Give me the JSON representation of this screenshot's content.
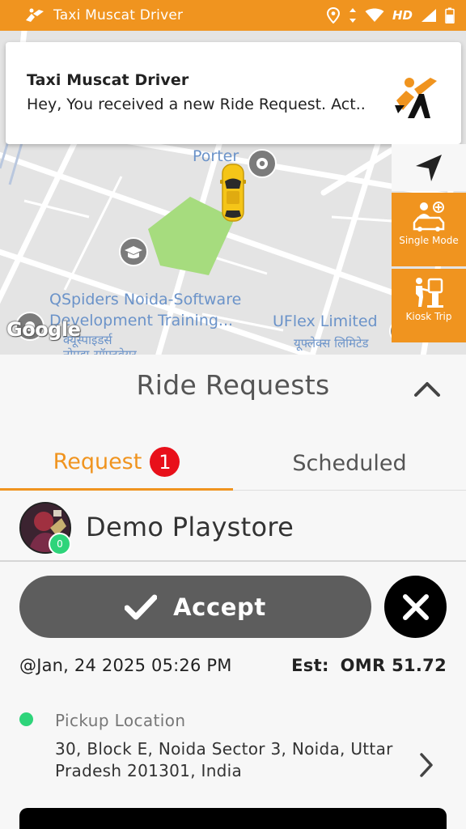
{
  "statusbar": {
    "app_name": "Taxi Muscat Driver",
    "network": "HD",
    "icons": [
      "app-taxi-icon",
      "location-icon",
      "data-arrows-icon",
      "wifi-icon",
      "signal-icon",
      "battery-icon"
    ]
  },
  "notification": {
    "title": "Taxi Muscat Driver",
    "body": "Hey, You received a new Ride Request. Act..",
    "logo": "taxi-logo-icon"
  },
  "map": {
    "pois": {
      "porter": "Porter",
      "qspiders_line1": "QSpiders Noida-Software",
      "qspiders_line2": "Development Training...",
      "qspiders_hindi1": "क्यूस्पाइडर्स",
      "qspiders_hindi2": "नोएडा-सॉफ्टवेयर",
      "uflex": "UFlex Limited",
      "uflex_hindi": "यूफ्लेक्स लिमिटेड"
    },
    "attribution": "Google"
  },
  "side_buttons": {
    "single_mode": "Single Mode",
    "kiosk_trip": "Kiosk Trip"
  },
  "sheet": {
    "title": "Ride Requests",
    "tabs": {
      "request": "Request",
      "request_count": "1",
      "scheduled": "Scheduled"
    },
    "rider": {
      "name": "Demo Playstore",
      "rating": "0"
    },
    "accept_label": "Accept",
    "datetime": "@Jan, 24 2025 05:26 PM",
    "est_label": "Est:",
    "est_value": "OMR 51.72",
    "pickup_label": "Pickup Location",
    "pickup_address": "30, Block E, Noida Sector 3, Noida, Uttar Pradesh 201301, India"
  },
  "colors": {
    "brand": "#f0941f",
    "badge": "#e8101a",
    "online": "#2ed47a",
    "accept_bg": "#5d5d5d"
  }
}
